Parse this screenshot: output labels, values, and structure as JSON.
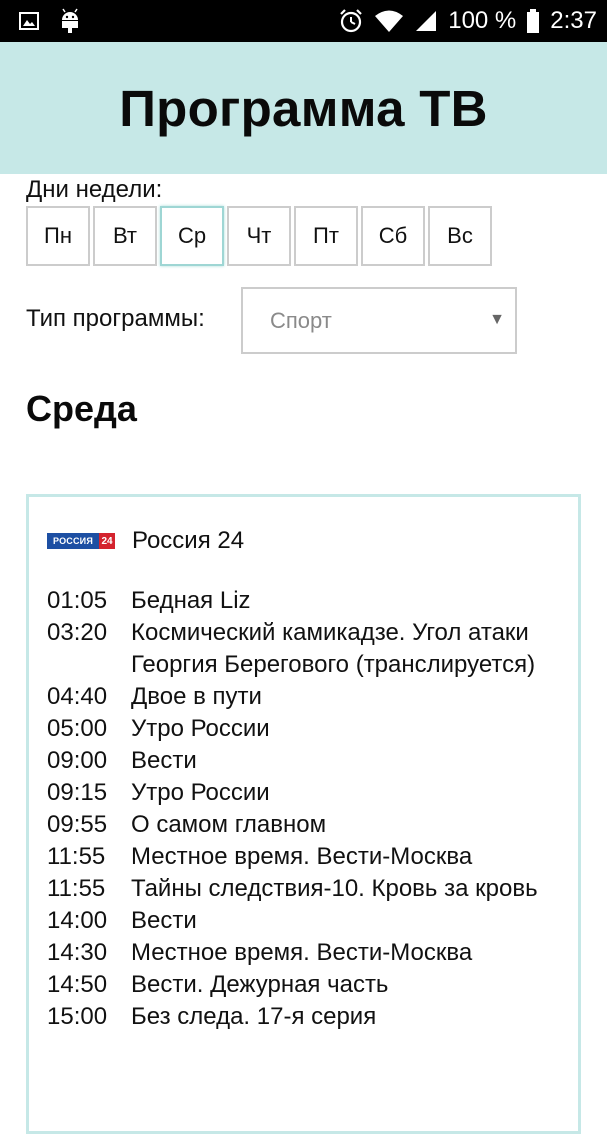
{
  "status_bar": {
    "battery_text": "100 %",
    "time": "2:37",
    "icons": [
      "image-icon",
      "android-icon",
      "alarm-icon",
      "wifi-icon",
      "signal-icon",
      "battery-icon"
    ]
  },
  "header": {
    "title": "Программа ТВ"
  },
  "days": {
    "label": "Дни недели:",
    "items": [
      "Пн",
      "Вт",
      "Ср",
      "Чт",
      "Пт",
      "Сб",
      "Вс"
    ],
    "selected": "Ср"
  },
  "program_type": {
    "label": "Тип программы:",
    "value": "Спорт"
  },
  "day_heading": "Среда",
  "channel": {
    "logo_left": "РОССИЯ",
    "logo_right": "24",
    "name": "Россия 24",
    "schedule": [
      {
        "time": "01:05",
        "title": "Бедная Liz"
      },
      {
        "time": "03:20",
        "title": "Космический камикадзе. Угол атаки Георгия Берегового (транслируется)"
      },
      {
        "time": "04:40",
        "title": "Двое в пути"
      },
      {
        "time": "05:00",
        "title": "Утро России"
      },
      {
        "time": "09:00",
        "title": "Вести"
      },
      {
        "time": "09:15",
        "title": "Утро России"
      },
      {
        "time": "09:55",
        "title": "О самом главном"
      },
      {
        "time": "11:55",
        "title": "Местное время. Вести-Москва"
      },
      {
        "time": "11:55",
        "title": "Тайны следствия-10. Кровь за кровь"
      },
      {
        "time": "14:00",
        "title": "Вести"
      },
      {
        "time": "14:30",
        "title": "Местное время. Вести-Москва"
      },
      {
        "time": "14:50",
        "title": "Вести. Дежурная часть"
      },
      {
        "time": "15:00",
        "title": "Без следа. 17-я серия"
      }
    ]
  },
  "colors": {
    "header_bg": "#c6e8e7",
    "active_border": "#9ed6d4",
    "logo_blue": "#1d4fa3",
    "logo_red": "#d4232e"
  }
}
